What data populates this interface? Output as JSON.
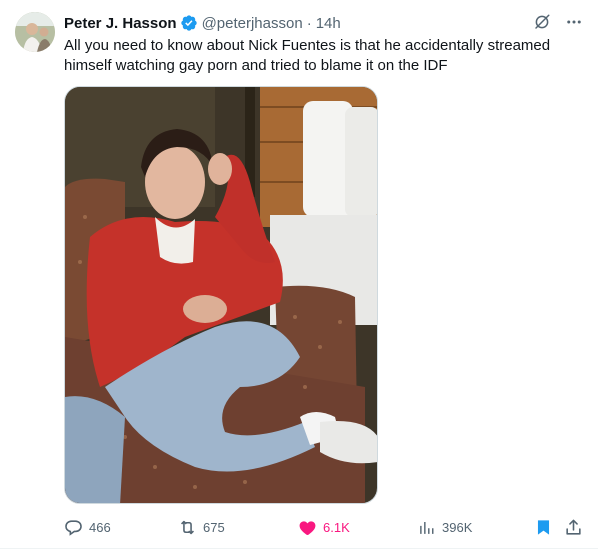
{
  "author": {
    "name": "Peter J. Hasson",
    "handle": "@peterjhasson",
    "separator": "·",
    "time": "14h",
    "verified": true
  },
  "tweet": {
    "text": "All you need to know about Nick Fuentes is that he accidentally streamed himself watching gay porn and tried to blame it on the IDF"
  },
  "media": {
    "type": "photo",
    "description_icon": "photo"
  },
  "actions": {
    "replies": "466",
    "retweets": "675",
    "likes": "6.1K",
    "views": "396K"
  },
  "colors": {
    "accent": "#1d9bf0",
    "like": "#f91880",
    "secondary_text": "#536471",
    "primary_text": "#0f1419"
  }
}
